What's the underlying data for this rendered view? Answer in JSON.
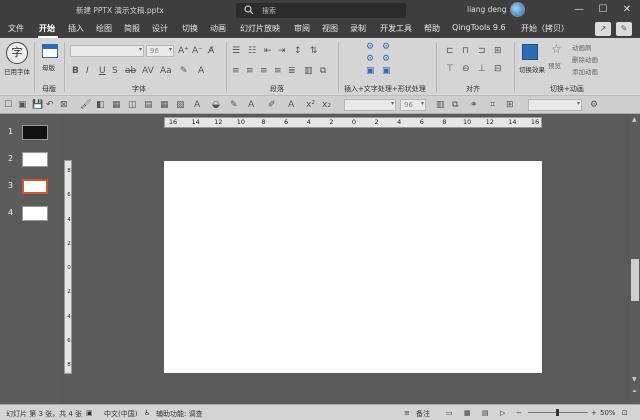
{
  "titlebar": {
    "doc_title": "新建 PPTX 演示文稿.pptx",
    "search_placeholder": "搜索",
    "user_name": "liang deng",
    "buttons": [
      "—",
      "☐",
      "✕"
    ]
  },
  "tabs": [
    "文件",
    "开始",
    "插入",
    "绘图",
    "简报",
    "设计",
    "切换",
    "动画",
    "幻灯片放映",
    "审阅",
    "视图",
    "录制",
    "开发工具",
    "帮助",
    "QingTools 9.6",
    "开始（拷贝）"
  ],
  "ribbon": {
    "font_name": "",
    "font_size": "96",
    "recent_font_button": "已用字体",
    "master_button": "母版",
    "transition_effect_button": "切换效果",
    "preview_button": "预览",
    "anim_labels": [
      "动画刷",
      "删除动画",
      "添加动画"
    ],
    "lower_combo_size": "96",
    "insert_text_label": "插入+文字处理+形状处理",
    "groups": {
      "master": "母版",
      "font": "字体",
      "paragraph": "段落",
      "align": "对齐",
      "transition": "切换+动画"
    }
  },
  "slides": [
    "1",
    "2",
    "3",
    "4"
  ],
  "selected_slide": 3,
  "ruler": {
    "h_ticks": [
      "16",
      "14",
      "12",
      "10",
      "8",
      "6",
      "4",
      "2",
      "0",
      "2",
      "4",
      "6",
      "8",
      "10",
      "12",
      "14",
      "16"
    ],
    "v_ticks": [
      "8",
      "6",
      "4",
      "2",
      "0",
      "2",
      "4",
      "6",
      "8"
    ]
  },
  "statusbar": {
    "slide_info": "幻灯片 第 3 张，共 4 张",
    "language": "中文(中国)",
    "accessibility": "辅助功能: 调查",
    "notes": "备注",
    "zoom": "50%"
  }
}
